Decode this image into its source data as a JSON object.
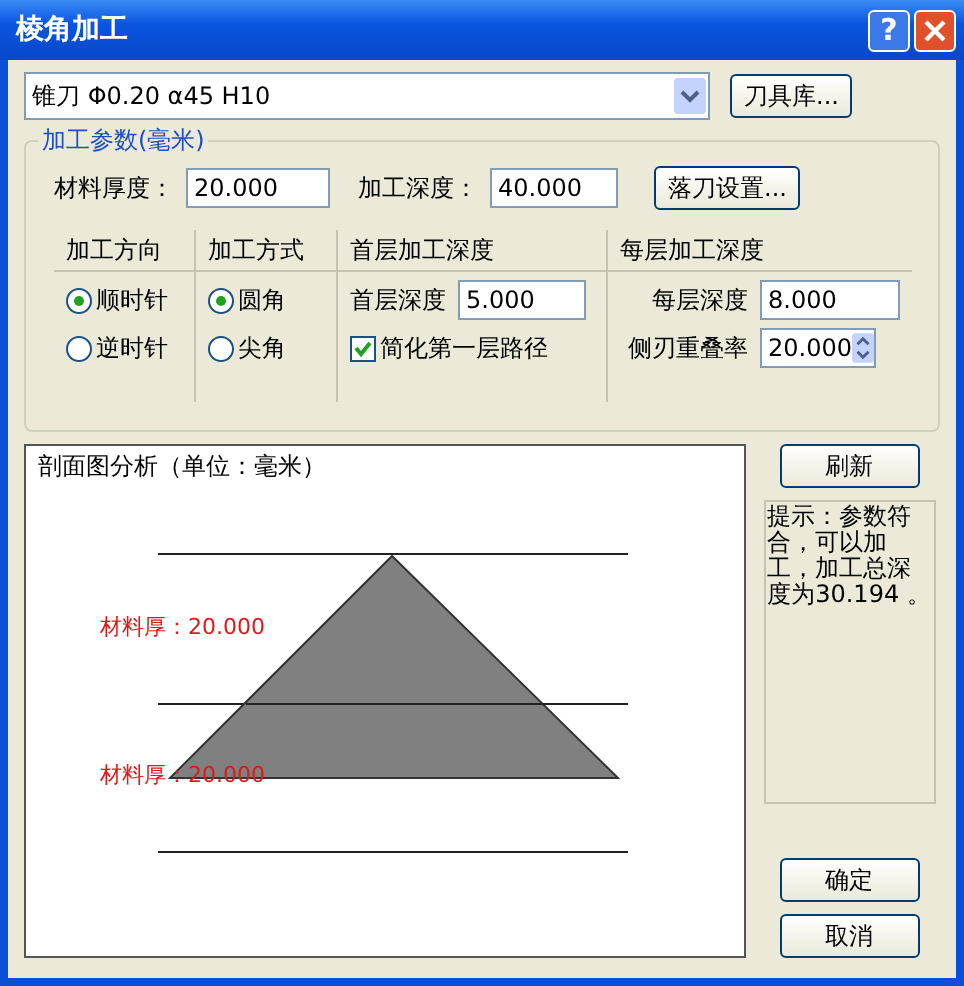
{
  "window": {
    "title": "棱角加工",
    "help_button": "?"
  },
  "tool_select": {
    "value": "锥刀 Φ0.20 α45 H10"
  },
  "tool_library_button": "刀具库...",
  "params": {
    "title": "加工参数(毫米)",
    "material_thickness": {
      "label": "材料厚度：",
      "value": "20.000"
    },
    "machining_depth": {
      "label": "加工深度：",
      "value": "40.000"
    },
    "plunge_button": "落刀设置...",
    "direction": {
      "heading": "加工方向",
      "options": [
        {
          "label": "顺时针",
          "selected": true
        },
        {
          "label": "逆时针",
          "selected": false
        }
      ]
    },
    "mode": {
      "heading": "加工方式",
      "options": [
        {
          "label": "圆角",
          "selected": true
        },
        {
          "label": "尖角",
          "selected": false
        }
      ]
    },
    "first_layer": {
      "heading": "首层加工深度",
      "depth": {
        "label": "首层深度",
        "value": "5.000"
      },
      "simplify": {
        "label": "简化第一层路径",
        "checked": true
      }
    },
    "per_layer": {
      "heading": "每层加工深度",
      "depth": {
        "label": "每层深度",
        "value": "8.000"
      },
      "overlap": {
        "label": "侧刃重叠率",
        "value": "20.000"
      }
    }
  },
  "profile": {
    "title": "剖面图分析（单位：毫米）",
    "labels": [
      "材料厚：20.000",
      "材料厚：20.000"
    ]
  },
  "refresh_button": "刷新",
  "hint": "提示：参数符合，可以加工，加工总深度为30.194 。",
  "buttons": [
    "确定",
    "取消"
  ]
}
